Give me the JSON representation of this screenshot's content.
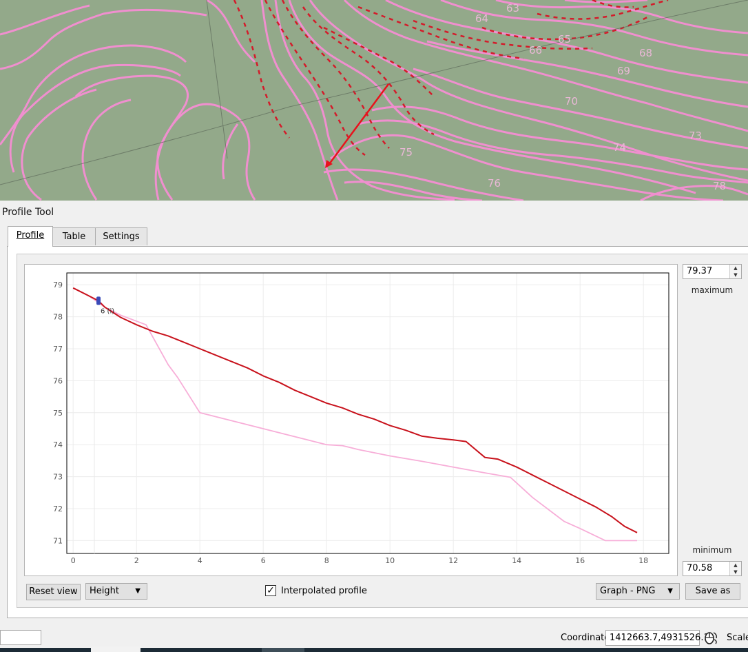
{
  "map": {
    "contour_labels": [
      "63",
      "64",
      "65",
      "66",
      "68",
      "69",
      "70",
      "73",
      "74",
      "75",
      "76",
      "78"
    ],
    "colors": {
      "background": "#93a98a",
      "contour_line": "#f08fcf",
      "dashed_contour": "#d41b2a",
      "profile_arrow": "#e8121c",
      "label_text": "#e9b8d6"
    }
  },
  "dock": {
    "title": "Profile Tool"
  },
  "tabs": [
    {
      "label": "Profile",
      "active": true
    },
    {
      "label": "Table",
      "active": false
    },
    {
      "label": "Settings",
      "active": false
    }
  ],
  "axis_controls": {
    "maximum": {
      "value": "79.37",
      "label": "maximum"
    },
    "minimum": {
      "value": "70.58",
      "label": "minimum"
    }
  },
  "chart_data": {
    "type": "line",
    "xlim": [
      -0.2,
      18.8
    ],
    "ylim": [
      70.6,
      79.37
    ],
    "x_ticks": [
      0,
      2,
      4,
      6,
      8,
      10,
      12,
      14,
      16,
      18
    ],
    "y_ticks": [
      71,
      72,
      73,
      74,
      75,
      76,
      77,
      78,
      79
    ],
    "grid": true,
    "series": [
      {
        "color": "#c8121c",
        "x": [
          0,
          0.5,
          0.8,
          1,
          1.5,
          2,
          2.5,
          3,
          3.5,
          4,
          4.5,
          5,
          5.5,
          6,
          6.5,
          7,
          7.5,
          8,
          8.5,
          9,
          9.5,
          10,
          10.5,
          11,
          11.5,
          12,
          12.4,
          13,
          13.4,
          14,
          14.5,
          15,
          15.5,
          16,
          16.5,
          17,
          17.4,
          17.8
        ],
        "y": [
          78.9,
          78.65,
          78.5,
          78.3,
          77.98,
          77.75,
          77.55,
          77.4,
          77.2,
          77.0,
          76.8,
          76.6,
          76.4,
          76.15,
          75.95,
          75.7,
          75.5,
          75.3,
          75.15,
          74.95,
          74.8,
          74.6,
          74.45,
          74.27,
          74.2,
          74.15,
          74.1,
          73.6,
          73.55,
          73.3,
          73.05,
          72.8,
          72.55,
          72.3,
          72.05,
          71.75,
          71.45,
          71.25
        ]
      },
      {
        "color": "#f7aed8",
        "x": [
          0,
          0.5,
          1,
          1.5,
          2.3,
          3,
          3.3,
          4,
          5,
          6,
          7,
          8,
          8.5,
          9,
          10,
          11,
          12,
          13,
          13.8,
          14.5,
          15.5,
          16,
          16.8,
          17.8
        ],
        "y": [
          78.9,
          78.65,
          78.3,
          78.05,
          77.75,
          76.5,
          76.1,
          75.0,
          74.75,
          74.5,
          74.25,
          74.0,
          73.97,
          73.85,
          73.65,
          73.48,
          73.3,
          73.12,
          72.98,
          72.35,
          71.6,
          71.38,
          71.0,
          71.0
        ]
      }
    ],
    "marker": {
      "x": 0.8,
      "y": 78.5,
      "color": "#3a4bb8",
      "label": "6 (i)"
    }
  },
  "controls": {
    "reset_label": "Reset view",
    "height_combo": "Height",
    "interpolated_checked": "✓",
    "interpolated_label": "Interpolated profile",
    "format_combo": "Graph - PNG",
    "save_label": "Save as"
  },
  "statusbar": {
    "coordinate_label": "Coordinate",
    "coordinate_value": "1412663.7,4931526.1",
    "scale_label": "Scale"
  }
}
